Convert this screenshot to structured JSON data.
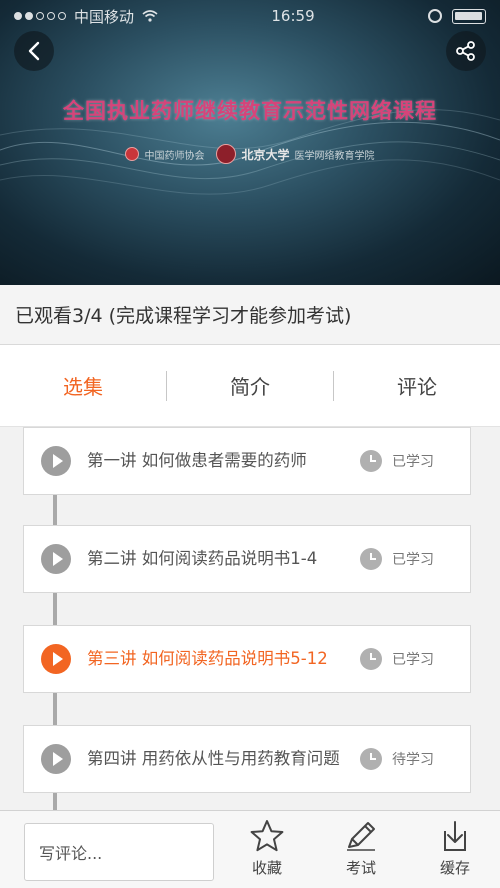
{
  "status_bar": {
    "carrier": "中国移动",
    "time": "16:59"
  },
  "hero": {
    "title": "全国执业药师继续教育示范性网络课程",
    "org1": "中国药师协会",
    "org2_name": "北京大学",
    "org2_dept": "医学网络教育学院"
  },
  "progress": {
    "text": "已观看3/4 (完成课程学习才能参加考试)",
    "watched": 3,
    "total": 4
  },
  "tabs": [
    {
      "label": "选集",
      "active": true
    },
    {
      "label": "简介",
      "active": false
    },
    {
      "label": "评论",
      "active": false
    }
  ],
  "lessons": [
    {
      "title": "第一讲 如何做患者需要的药师",
      "status": "已学习",
      "active": false
    },
    {
      "title": "第二讲 如何阅读药品说明书1-4",
      "status": "已学习",
      "active": false
    },
    {
      "title": "第三讲 如何阅读药品说明书5-12",
      "status": "已学习",
      "active": true
    },
    {
      "title": "第四讲 用药依从性与用药教育问题",
      "status": "待学习",
      "active": false
    }
  ],
  "bottom_bar": {
    "comment_placeholder": "写评论...",
    "favorite": "收藏",
    "exam": "考试",
    "download": "缓存"
  },
  "colors": {
    "accent": "#f26522",
    "muted": "#9e9e9e"
  }
}
